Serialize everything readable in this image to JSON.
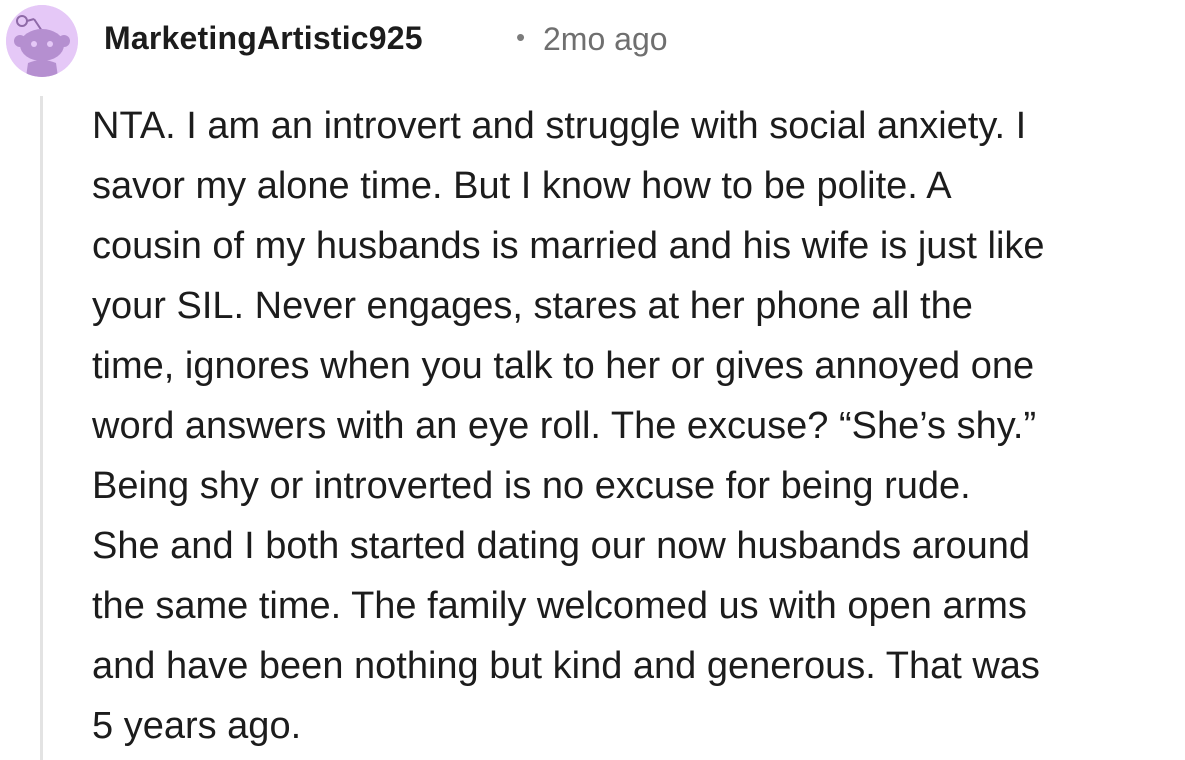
{
  "comment": {
    "author": "MarketingArtistic925",
    "separator": "•",
    "timestamp": "2mo ago",
    "avatar_icon": "snoo-avatar-icon",
    "avatar_color": "#e5c8f7",
    "body_lines": [
      "NTA. I am an introvert and struggle with social anxiety. I",
      "savor my alone time. But I know how to be polite. A",
      "cousin of my husbands is married and his wife is just like",
      "your SIL. Never engages, stares at her phone all the",
      "time, ignores when you talk to her or gives annoyed one",
      "word answers with an eye roll. The excuse? “She’s shy.”",
      "Being shy or introverted is no excuse for being rude.",
      "She and I both started dating our now husbands around",
      "the same time. The family welcomed us with open arms",
      "and have been nothing but kind and generous. That was",
      "5 years ago."
    ]
  }
}
